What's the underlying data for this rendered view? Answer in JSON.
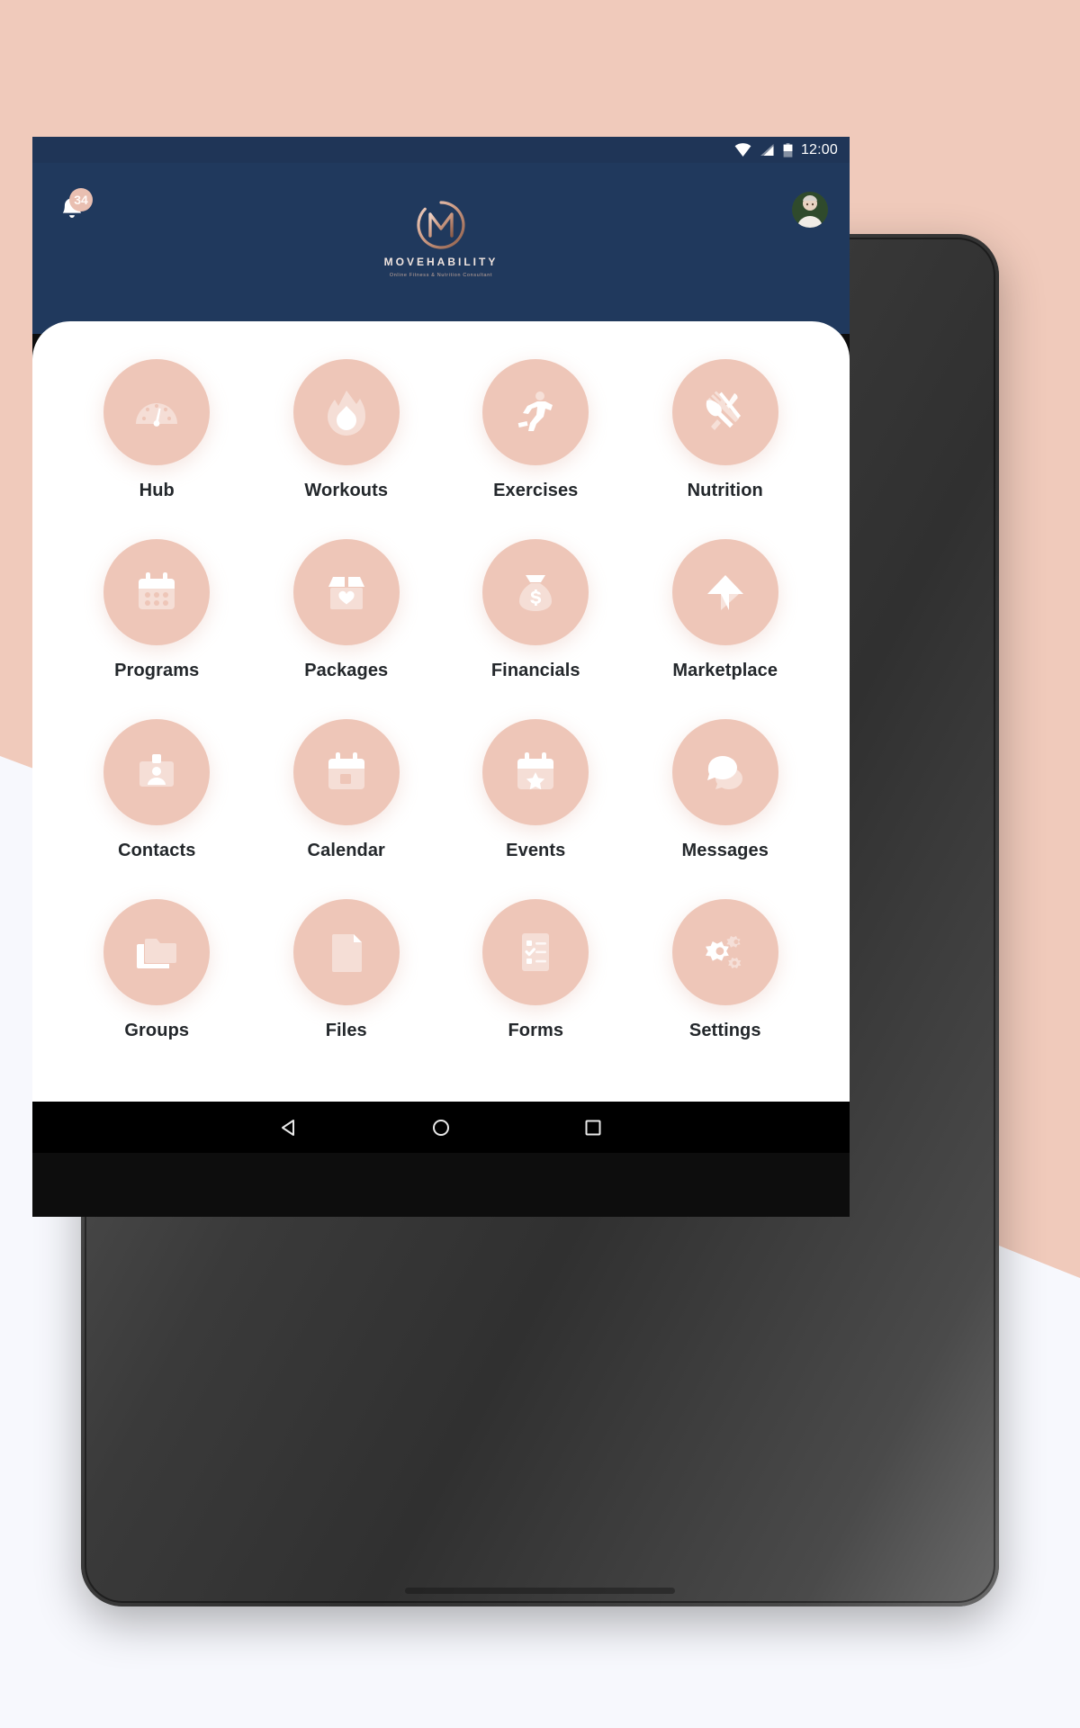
{
  "wallpaper": {
    "top_color": "#f0cabb",
    "bottom_color": "#f7f8fd"
  },
  "device": {
    "bezel_color": "#3b3b3b",
    "camera_name": "front-camera"
  },
  "status_bar": {
    "time": "12:00",
    "background": "#1f3557",
    "icons": [
      "wifi-icon",
      "cellular-signal-icon",
      "battery-icon"
    ]
  },
  "app_header": {
    "background": "#20395d",
    "notification": {
      "icon": "bell-icon",
      "badge_count": "34",
      "badge_color": "#e9bfb1"
    },
    "logo": {
      "monogram": "M",
      "name": "MOVEHABILITY",
      "tagline": "Online Fitness & Nutrition Consultant"
    },
    "avatar": {
      "name": "user-avatar"
    }
  },
  "main": {
    "sheet_background": "#ffffff",
    "tile_circle_color": "#eec6b8",
    "tiles": [
      {
        "label": "Hub",
        "icon": "gauge-icon"
      },
      {
        "label": "Workouts",
        "icon": "flame-icon"
      },
      {
        "label": "Exercises",
        "icon": "running-person-icon"
      },
      {
        "label": "Nutrition",
        "icon": "fork-knife-icon"
      },
      {
        "label": "Programs",
        "icon": "calendar-dots-icon"
      },
      {
        "label": "Packages",
        "icon": "box-heart-icon"
      },
      {
        "label": "Financials",
        "icon": "money-bag-icon"
      },
      {
        "label": "Marketplace",
        "icon": "store-arrow-icon"
      },
      {
        "label": "Contacts",
        "icon": "id-badge-icon"
      },
      {
        "label": "Calendar",
        "icon": "calendar-icon"
      },
      {
        "label": "Events",
        "icon": "calendar-star-icon"
      },
      {
        "label": "Messages",
        "icon": "chat-bubbles-icon"
      },
      {
        "label": "Groups",
        "icon": "folders-icon"
      },
      {
        "label": "Files",
        "icon": "document-icon"
      },
      {
        "label": "Forms",
        "icon": "checklist-icon"
      },
      {
        "label": "Settings",
        "icon": "gears-icon"
      }
    ]
  },
  "nav_bar": {
    "background": "#000000",
    "buttons": [
      {
        "name": "back-button",
        "icon": "triangle-left-icon"
      },
      {
        "name": "home-button",
        "icon": "circle-icon"
      },
      {
        "name": "recents-button",
        "icon": "square-icon"
      }
    ]
  }
}
